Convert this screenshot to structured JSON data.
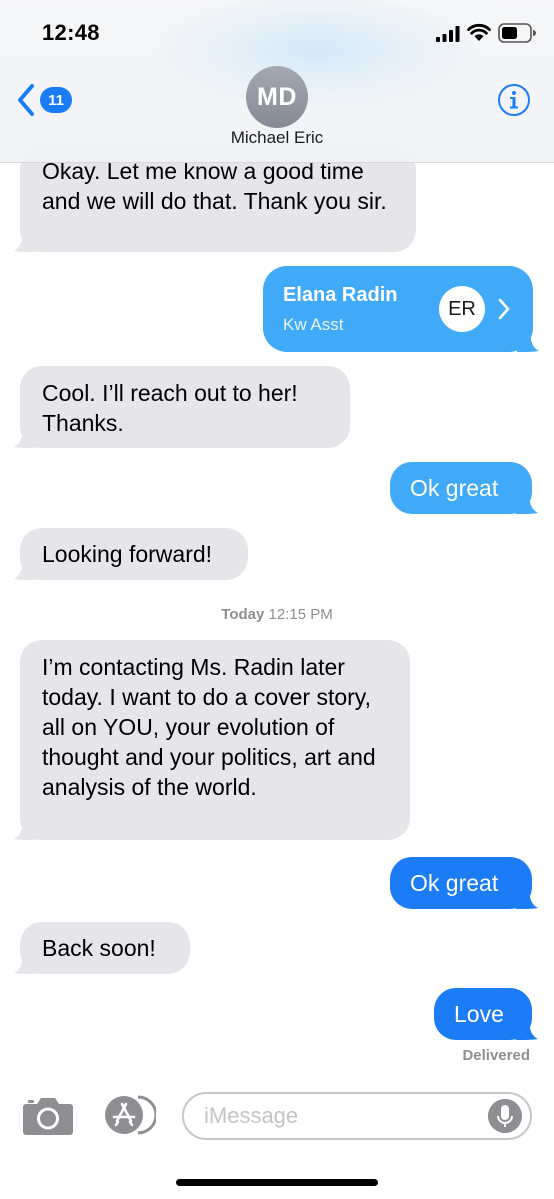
{
  "status_bar": {
    "time": "12:48",
    "icons": [
      "signal-icon",
      "wifi-icon",
      "battery-icon"
    ]
  },
  "header": {
    "back_badge": "11",
    "avatar_initials": "MD",
    "contact_name": "Michael Eric",
    "icons": [
      "chevron-left-icon",
      "info-icon"
    ]
  },
  "messages": {
    "m1": "Okay. Let me know a good time and we will do that. Thank you sir.",
    "contact_card": {
      "name": "Elana Radin",
      "subtitle": "Kw Asst",
      "initials": "ER"
    },
    "m3": "Cool. I’ll reach out to her! Thanks.",
    "m4": "Ok great",
    "m5": "Looking forward!",
    "timestamp_day": "Today",
    "timestamp_time": "12:15 PM",
    "m6": "I’m contacting Ms. Radin later today. I want to do a cover story, all on YOU, your evolution of thought and your politics, art and analysis of the world.",
    "m7": "Ok great",
    "m8": "Back soon!",
    "m9": "Love",
    "delivered": "Delivered"
  },
  "compose": {
    "placeholder": "iMessage",
    "icons": [
      "camera-icon",
      "app-store-icon",
      "microphone-icon"
    ]
  },
  "colors": {
    "imessage_blue": "#1b7cf5",
    "sms_blue": "#40aaf8",
    "received_gray": "#e5e5ea",
    "meta_gray": "#8e8e93"
  }
}
